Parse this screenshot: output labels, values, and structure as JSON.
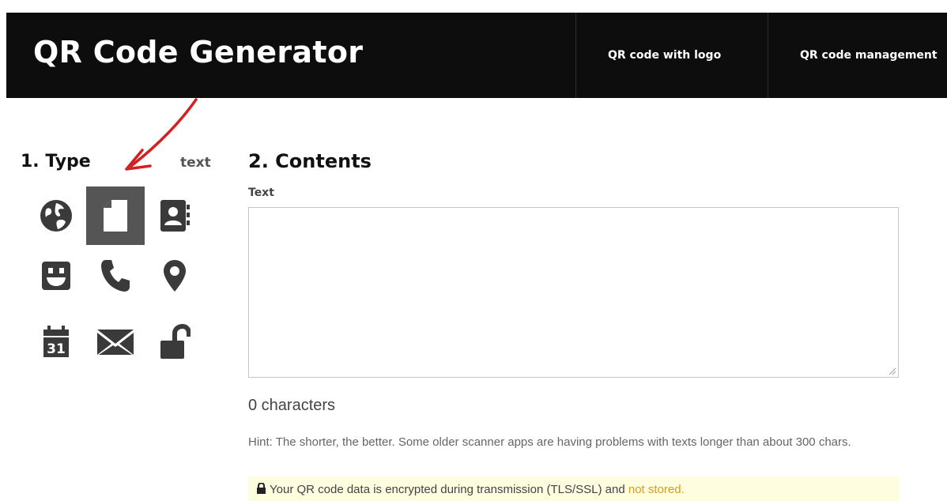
{
  "header": {
    "brand": "QR Code Generator",
    "nav": [
      {
        "label": "QR code with logo"
      },
      {
        "label": "QR code management"
      }
    ]
  },
  "type_section": {
    "title": "1. Type",
    "current_type": "text",
    "types": [
      {
        "icon": "globe-icon",
        "label": "url"
      },
      {
        "icon": "document-icon",
        "label": "text",
        "selected": true
      },
      {
        "icon": "contact-card-icon",
        "label": "contact"
      },
      {
        "icon": "smiley-icon",
        "label": "social"
      },
      {
        "icon": "phone-icon",
        "label": "phone"
      },
      {
        "icon": "location-pin-icon",
        "label": "location"
      },
      {
        "icon": "calendar-icon",
        "label": "event",
        "day": "31"
      },
      {
        "icon": "envelope-icon",
        "label": "email"
      },
      {
        "icon": "unlocked-padlock-icon",
        "label": "wifi"
      }
    ]
  },
  "contents_section": {
    "title": "2. Contents",
    "text_label": "Text",
    "text_value": "",
    "char_count": "0 characters",
    "hint": "Hint: The shorter, the better. Some older scanner apps are having problems with texts longer than about 300 chars.",
    "security_note": "Your QR code data is encrypted during transmission (TLS/SSL) and ",
    "security_highlight": "not stored."
  },
  "colors": {
    "header_bg": "#0d0d0d",
    "selected_bg": "#555555",
    "icon_color": "#3a3a3a",
    "annotation_arrow": "#d42020",
    "notice_bg": "#fefde0",
    "notice_highlight": "#d4a017"
  }
}
